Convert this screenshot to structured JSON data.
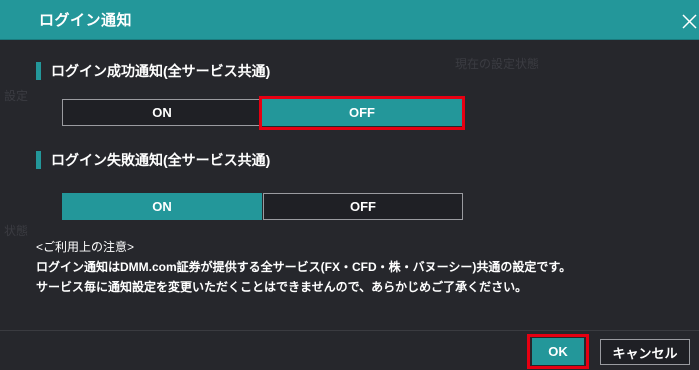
{
  "dialog": {
    "title": "ログイン通知",
    "close_icon": "close-icon"
  },
  "background_ghost": {
    "text_1": "現在の設定状態",
    "text_2": "設定",
    "text_3": "状態"
  },
  "success_section": {
    "label": "ログイン成功通知(全サービス共通)",
    "options": [
      {
        "label": "ON",
        "selected": false
      },
      {
        "label": "OFF",
        "selected": true
      }
    ]
  },
  "failure_section": {
    "label": "ログイン失敗通知(全サービス共通)",
    "options": [
      {
        "label": "ON",
        "selected": true
      },
      {
        "label": "OFF",
        "selected": false
      }
    ]
  },
  "notes": {
    "heading": "<ご利用上の注意>",
    "line1": "ログイン通知はDMM.com証券が提供する全サービス(FX・CFD・株・バヌーシー)共通の設定です。",
    "line2": "サービス毎に通知設定を変更いただくことはできませんので、あらかじめご了承ください。"
  },
  "footer": {
    "ok_label": "OK",
    "cancel_label": "キャンセル"
  },
  "colors": {
    "accent": "#23979a",
    "highlight": "#e60012",
    "background": "#26272c"
  }
}
